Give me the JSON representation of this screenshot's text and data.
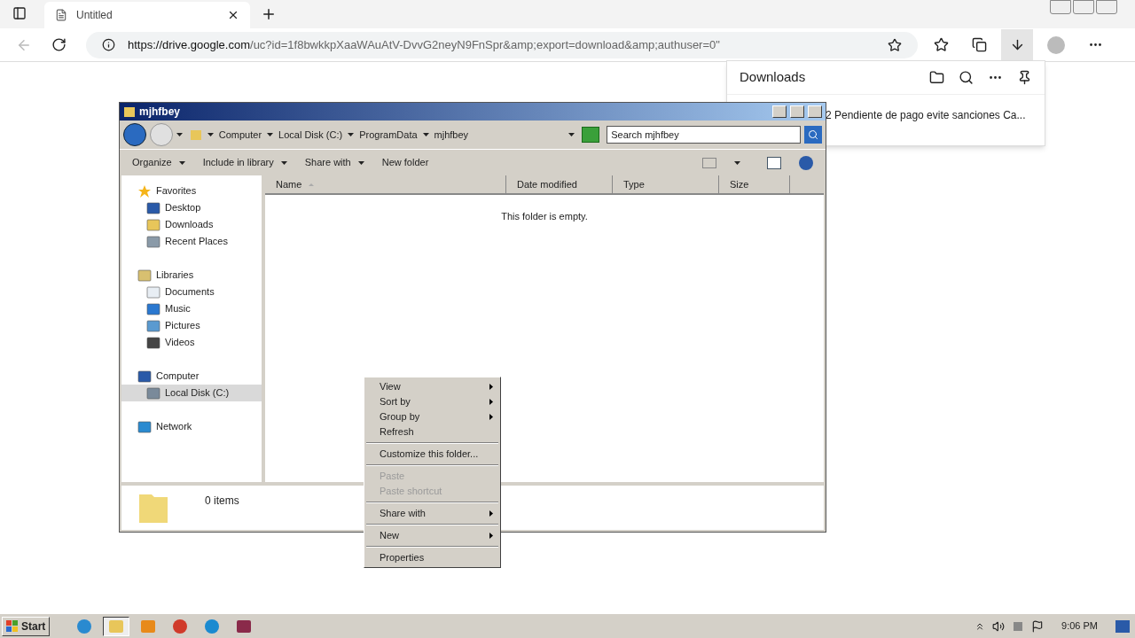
{
  "browser": {
    "tab": {
      "title": "Untitled"
    },
    "url_host": "https://drive.google.com",
    "url_rest": "/uc?id=1f8bwkkpXaaWAuAtV-DvvG2neyN9FnSpr&amp;export=download&amp;authuser=0\""
  },
  "downloads": {
    "title": "Downloads",
    "item": "2 Pendiente de pago evite sanciones Ca..."
  },
  "explorer": {
    "title": "mjhfbey",
    "breadcrumb": [
      "Computer",
      "Local Disk (C:)",
      "ProgramData",
      "mjhfbey"
    ],
    "search": {
      "placeholder": "Search mjhfbey"
    },
    "toolbar": [
      {
        "label": "Organize",
        "dropdown": true
      },
      {
        "label": "Include in library",
        "dropdown": true
      },
      {
        "label": "Share with",
        "dropdown": true
      },
      {
        "label": "New folder",
        "dropdown": false
      }
    ],
    "nav": [
      {
        "label": "Favorites",
        "selected": false,
        "children": [
          {
            "label": "Desktop",
            "selected": false
          },
          {
            "label": "Downloads",
            "selected": false
          },
          {
            "label": "Recent Places",
            "selected": false
          }
        ]
      },
      {
        "label": "Libraries",
        "selected": false,
        "children": [
          {
            "label": "Documents",
            "selected": false
          },
          {
            "label": "Music",
            "selected": false
          },
          {
            "label": "Pictures",
            "selected": false
          },
          {
            "label": "Videos",
            "selected": false
          }
        ]
      },
      {
        "label": "Computer",
        "selected": false,
        "children": [
          {
            "label": "Local Disk (C:)",
            "selected": true
          }
        ]
      },
      {
        "label": "Network",
        "selected": false
      }
    ],
    "columns": [
      "Name",
      "Date modified",
      "Type",
      "Size"
    ],
    "empty_message": "This folder is empty.",
    "status": "0 items"
  },
  "context_menu": [
    {
      "kind": "item",
      "label": "View",
      "submenu": true,
      "disabled": false
    },
    {
      "kind": "item",
      "label": "Sort by",
      "submenu": true,
      "disabled": false
    },
    {
      "kind": "item",
      "label": "Group by",
      "submenu": true,
      "disabled": false
    },
    {
      "kind": "item",
      "label": "Refresh",
      "submenu": false,
      "disabled": false
    },
    {
      "kind": "separator"
    },
    {
      "kind": "item",
      "label": "Customize this folder...",
      "submenu": false,
      "disabled": false
    },
    {
      "kind": "separator"
    },
    {
      "kind": "item",
      "label": "Paste",
      "submenu": false,
      "disabled": true
    },
    {
      "kind": "item",
      "label": "Paste shortcut",
      "submenu": false,
      "disabled": true
    },
    {
      "kind": "separator"
    },
    {
      "kind": "item",
      "label": "Share with",
      "submenu": true,
      "disabled": false
    },
    {
      "kind": "separator"
    },
    {
      "kind": "item",
      "label": "New",
      "submenu": true,
      "disabled": false
    },
    {
      "kind": "separator"
    },
    {
      "kind": "item",
      "label": "Properties",
      "submenu": false,
      "disabled": false
    }
  ],
  "taskbar": {
    "start": "Start",
    "apps": [
      {
        "selected": false
      },
      {
        "selected": true
      },
      {
        "selected": false
      },
      {
        "selected": false
      },
      {
        "selected": false
      },
      {
        "selected": false
      }
    ],
    "time": "9:06 PM"
  }
}
